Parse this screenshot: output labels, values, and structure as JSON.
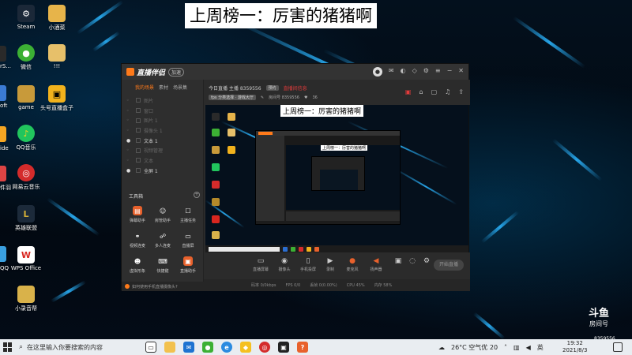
{
  "top_title": "上周榜一：厉害的猪猪啊",
  "desktop_icons": [
    {
      "label": "Steam",
      "icon": "steam-icon",
      "color": "#1b2838"
    },
    {
      "label": "小酒菜",
      "icon": "folder-icon",
      "color": "#e7b44a"
    },
    {
      "label": "微信",
      "icon": "wechat-icon",
      "color": "#3cb034"
    },
    {
      "label": "!!!",
      "icon": "file-icon",
      "color": "#e7c06a"
    },
    {
      "label": "game",
      "icon": "archive-icon",
      "color": "#c89a3a"
    },
    {
      "label": "头号直播盒子",
      "icon": "box-icon",
      "color": "#f2b21c"
    },
    {
      "label": "QQ音乐",
      "icon": "qqmusic-icon",
      "color": "#21c55d"
    },
    {
      "label": "网易云音乐",
      "icon": "netease-music-icon",
      "color": "#d42b2b"
    },
    {
      "label": "英雄联盟",
      "icon": "lol-icon",
      "color": "#b48a2a"
    },
    {
      "label": "WPS Office",
      "icon": "wps-icon",
      "color": "#d8261f"
    },
    {
      "label": "小录音帮",
      "icon": "recorder-icon",
      "color": "#d9b24a"
    }
  ],
  "edge_labels": [
    "rS...",
    "oft",
    "ide",
    "件羽",
    "QQ"
  ],
  "app": {
    "logo_text": "直播伴侣",
    "logo_badge": "加速",
    "left_tabs": [
      "我的场景",
      "素材",
      "场景集"
    ],
    "scenes": [
      {
        "label": "图片",
        "on": false
      },
      {
        "label": "窗口",
        "on": false
      },
      {
        "label": "图片 1",
        "on": false
      },
      {
        "label": "摄像头 1",
        "on": false
      },
      {
        "label": "文本 1",
        "on": true
      },
      {
        "label": "视频管理",
        "on": false
      },
      {
        "label": "文本",
        "on": false
      },
      {
        "label": "全屏 1",
        "on": true
      }
    ],
    "toolbox_title": "工具箱",
    "tools": [
      {
        "label": "弹幕助手",
        "icon": "danmu-icon",
        "color": "#e8612c"
      },
      {
        "label": "房管助手",
        "icon": "admin-icon",
        "color": "#555"
      },
      {
        "label": "主播任务",
        "icon": "task-icon",
        "color": "#555"
      },
      {
        "label": "视频连麦",
        "icon": "video-link-icon",
        "color": "#555"
      },
      {
        "label": "多人连麦",
        "icon": "multi-link-icon",
        "color": "#555"
      },
      {
        "label": "直播屏",
        "icon": "screen-icon",
        "color": "#555"
      },
      {
        "label": "虚拟形象",
        "icon": "avatar-icon",
        "color": "#555"
      },
      {
        "label": "快捷键",
        "icon": "hotkey-icon",
        "color": "#555"
      },
      {
        "label": "直播助手",
        "icon": "assistant-icon",
        "color": "#e8612c"
      }
    ],
    "bottom_tip": "如何使用手机直播摄像头?",
    "info": {
      "title": "今日直播 主播 8359556",
      "chip": "预约",
      "red_text": "直播间信息",
      "category": "fps 分类选择 · 游戏大厅",
      "room": "房间号 8359556",
      "fans": "36"
    },
    "preview_title": "上周榜一：厉害的猪猪啊",
    "nested_title": "上周榜一：厉害的猪猪啊",
    "controls": [
      {
        "label": "直播屏幕",
        "icon": "screen-capture-icon"
      },
      {
        "label": "摄像头",
        "icon": "camera-icon"
      },
      {
        "label": "手机投屏",
        "icon": "phone-cast-icon"
      },
      {
        "label": "录制",
        "icon": "record-icon"
      },
      {
        "label": "麦克风",
        "icon": "mic-icon"
      },
      {
        "label": "扬声器",
        "icon": "speaker-icon"
      }
    ],
    "go_live": "开始直播",
    "status": [
      "码率 0/0kbps",
      "FPS 0/0",
      "丢帧 0(0.00%)",
      "CPU 45%",
      "内存 58%"
    ]
  },
  "watermark": {
    "big": "斗鱼",
    "small": "房间号",
    "number": "8359556"
  },
  "taskbar": {
    "search_placeholder": "在这里输入你要搜索的内容",
    "weather": "26°C  空气优 20",
    "lang": "英",
    "time": "19:32",
    "date": "2021/8/3"
  }
}
